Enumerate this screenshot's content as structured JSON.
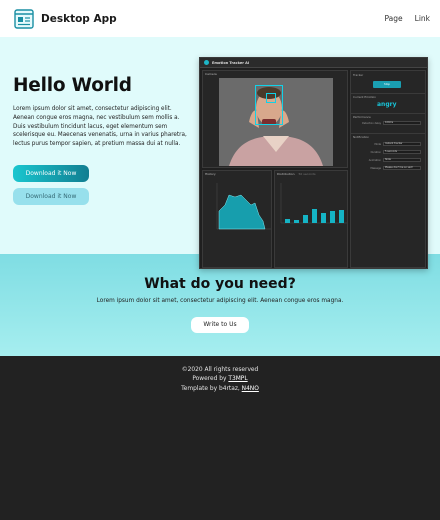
{
  "nav": {
    "brand": "Desktop App",
    "links": [
      "Page",
      "Link"
    ]
  },
  "hero": {
    "title": "Hello World",
    "text": "Lorem ipsum dolor sit amet, consectetur adipiscing elit. Aenean congue eros magna, nec vestibulum sem mollis a. Duis vestibulum tincidunt lacus, eget elementum sem scelerisque eu. Maecenas venenatis, urna in varius pharetra, lectus purus tempor sapien, at pretium massa dui at nulla.",
    "primary_button": "Download it Now",
    "secondary_button": "Download it Now",
    "screenshot": {
      "app_name": "Emotion Tracker AI",
      "camera_label": "Camera",
      "tracker_label": "Tracker",
      "stop_button": "Stop",
      "current_emotion_label": "Current Emotion",
      "current_emotion": "angry",
      "performance_label": "Performance",
      "detection_delay_label": "Detection delay",
      "detection_delay_value": "100ms",
      "notification_label": "Notification",
      "notif_rows": [
        {
          "label": "Mode",
          "value": "Instant tracker"
        },
        {
          "label": "Duration",
          "value": "5 seconds"
        },
        {
          "label": "Animation",
          "value": "Slide"
        },
        {
          "label": "Message",
          "value": "Please don't be so sad!"
        }
      ],
      "history_label": "History",
      "distribution_label": "Distribution",
      "distribution_subtitle": "50 seconds"
    }
  },
  "need": {
    "title": "What do you need?",
    "text": "Lorem ipsum dolor sit amet, consectetur adipiscing elit. Aenean congue eros magna.",
    "button": "Write to Us"
  },
  "footer": {
    "copyright": "©2020 All rights reserved",
    "powered_prefix": "Powered by",
    "powered_link": "T3MPL",
    "template_prefix": "Template by b4rtaz,",
    "template_link": "N4NO"
  },
  "colors": {
    "hero_bg": "#e0fbfb",
    "accent": "#1ac6cf",
    "need_bg": "#8fe4e9",
    "footer_bg": "#222222"
  }
}
